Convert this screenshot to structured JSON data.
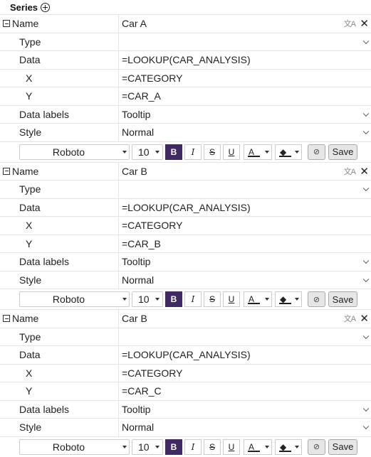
{
  "header": {
    "title": "Series",
    "add_icon": "circle-plus-icon"
  },
  "labels": {
    "name": "Name",
    "type": "Type",
    "data": "Data",
    "x": "X",
    "y": "Y",
    "data_labels": "Data labels",
    "style": "Style"
  },
  "series": [
    {
      "name": "Car A",
      "type": "",
      "data": "=LOOKUP(CAR_ANALYSIS)",
      "x": "=CATEGORY",
      "y": "=CAR_A",
      "data_labels": "Tooltip",
      "style": "Normal",
      "toolbar": {
        "font": "Roboto",
        "size": "10",
        "bold": "B",
        "italic": "I",
        "strike": "S",
        "underline": "U",
        "font_color": "A",
        "fill": "◆",
        "reset": "⊘",
        "save": "Save"
      }
    },
    {
      "name": "Car B",
      "type": "",
      "data": "=LOOKUP(CAR_ANALYSIS)",
      "x": "=CATEGORY",
      "y": "=CAR_B",
      "data_labels": "Tooltip",
      "style": "Normal",
      "toolbar": {
        "font": "Roboto",
        "size": "10",
        "bold": "B",
        "italic": "I",
        "strike": "S",
        "underline": "U",
        "font_color": "A",
        "fill": "◆",
        "reset": "⊘",
        "save": "Save"
      }
    },
    {
      "name": "Car B",
      "type": "",
      "data": "=LOOKUP(CAR_ANALYSIS)",
      "x": "=CATEGORY",
      "y": "=CAR_C",
      "data_labels": "Tooltip",
      "style": "Normal",
      "toolbar": {
        "font": "Roboto",
        "size": "10",
        "bold": "B",
        "italic": "I",
        "strike": "S",
        "underline": "U",
        "font_color": "A",
        "fill": "◆",
        "reset": "⊘",
        "save": "Save"
      }
    }
  ],
  "icons": {
    "collapse": "minus-square-icon",
    "translate": "translate-icon",
    "close": "close-icon",
    "dropdown": "chevron-down-icon"
  }
}
